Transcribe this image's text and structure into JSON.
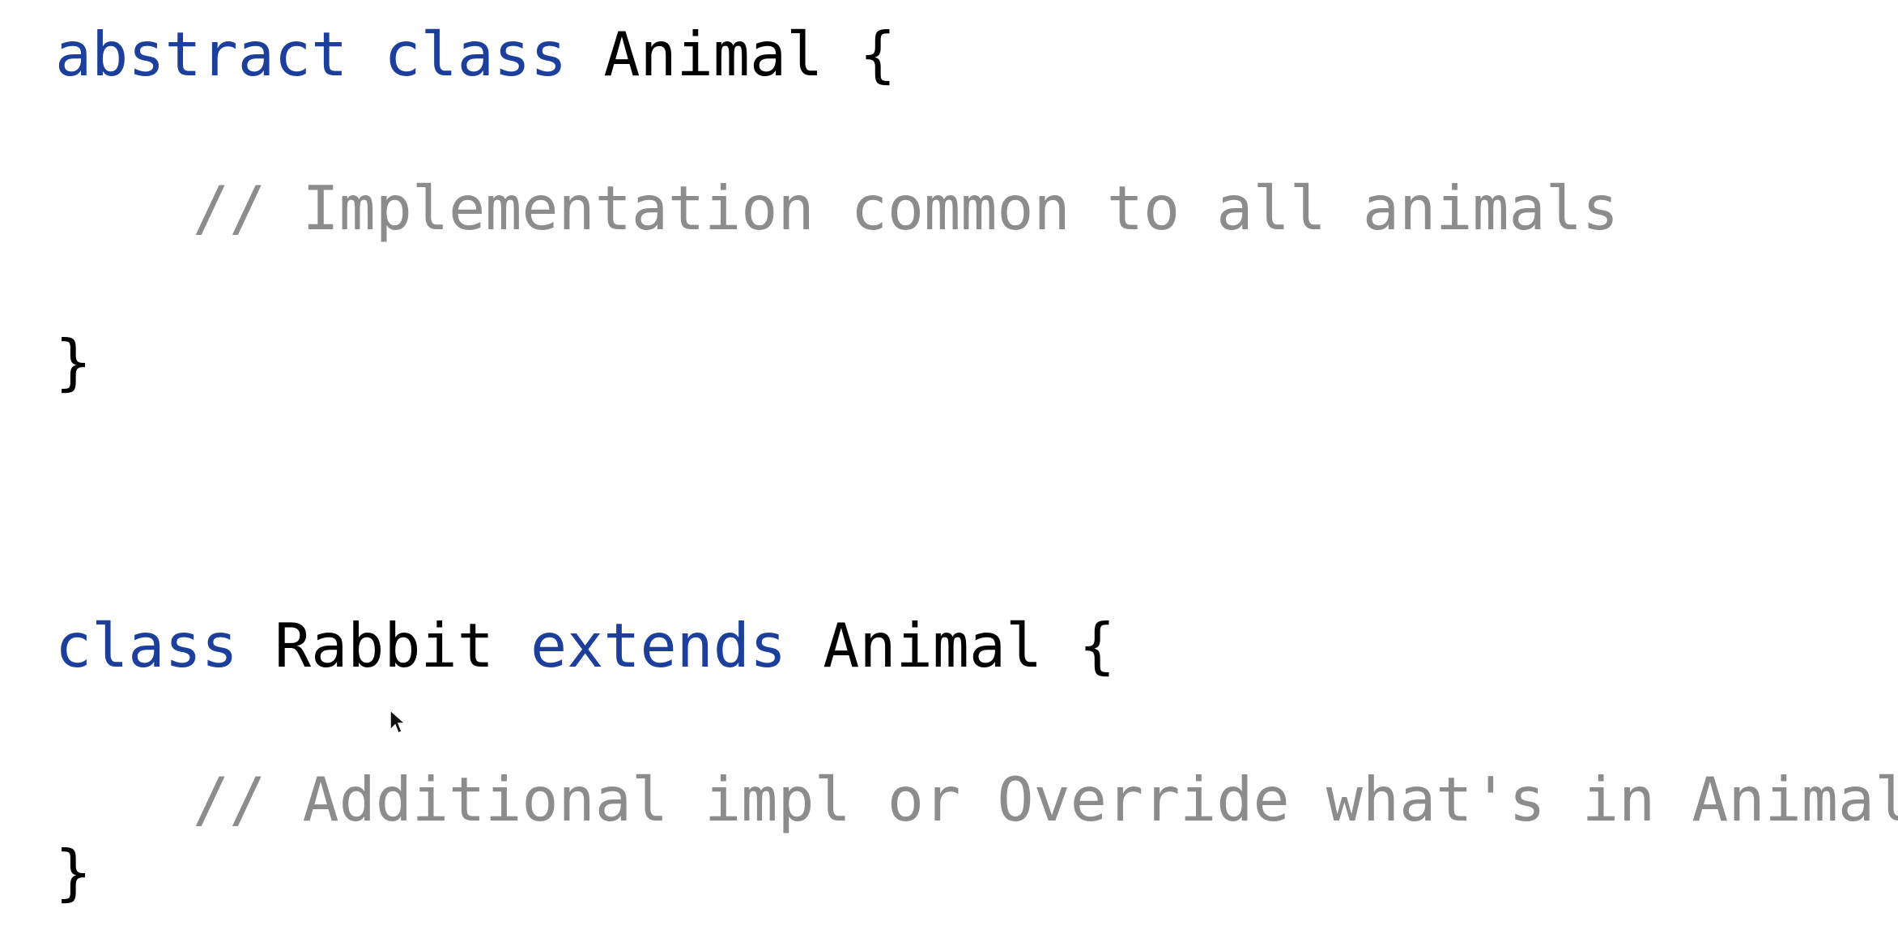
{
  "code": {
    "line1": {
      "kw_abstract": "abstract",
      "kw_class": "class",
      "name": "Animal",
      "brace_open": "{"
    },
    "line2": {
      "comment": "// Implementation common to all animals"
    },
    "line3": {
      "brace_close": "}"
    },
    "line4": {
      "kw_class": "class",
      "name": "Rabbit",
      "kw_extends": "extends",
      "parent": "Animal",
      "brace_open": "{"
    },
    "line5": {
      "comment": "// Additional impl or Override what's in Animal"
    },
    "line6": {
      "brace_close": "}"
    }
  },
  "colors": {
    "keyword": "#1c3f9c",
    "identifier": "#000000",
    "comment": "#8c8c8c",
    "background": "#ffffff"
  },
  "icons": {
    "cursor": "mouse-pointer-icon"
  }
}
